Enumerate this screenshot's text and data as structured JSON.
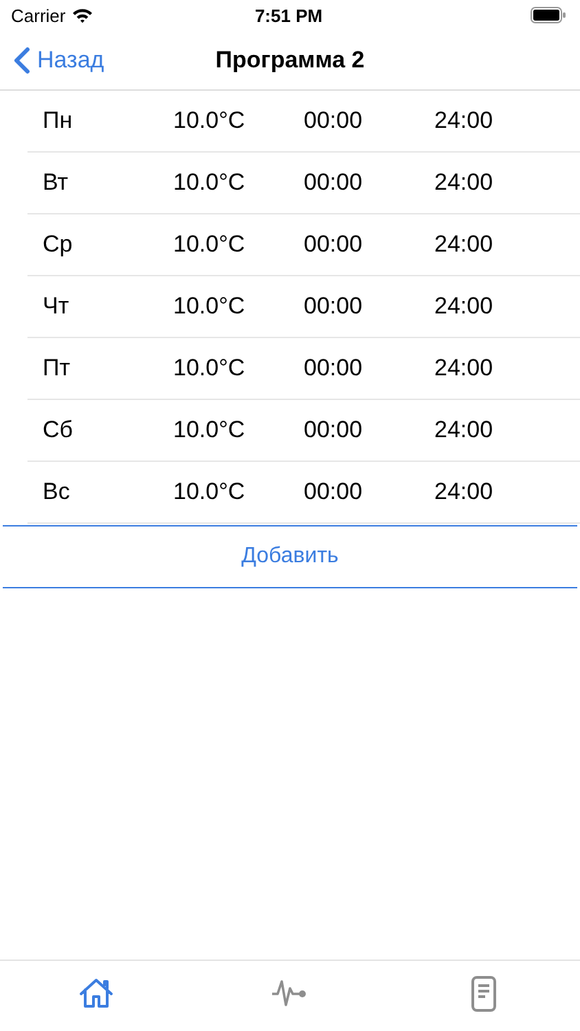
{
  "status_bar": {
    "carrier": "Carrier",
    "time": "7:51 PM"
  },
  "nav": {
    "back": "Назад",
    "title": "Программа 2"
  },
  "rows": [
    {
      "day": "Пн",
      "temperature": "10.0°C",
      "start": "00:00",
      "end": "24:00"
    },
    {
      "day": "Вт",
      "temperature": "10.0°C",
      "start": "00:00",
      "end": "24:00"
    },
    {
      "day": "Ср",
      "temperature": "10.0°C",
      "start": "00:00",
      "end": "24:00"
    },
    {
      "day": "Чт",
      "temperature": "10.0°C",
      "start": "00:00",
      "end": "24:00"
    },
    {
      "day": "Пт",
      "temperature": "10.0°C",
      "start": "00:00",
      "end": "24:00"
    },
    {
      "day": "Сб",
      "temperature": "10.0°C",
      "start": "00:00",
      "end": "24:00"
    },
    {
      "day": "Вс",
      "temperature": "10.0°C",
      "start": "00:00",
      "end": "24:00"
    }
  ],
  "add_button": "Добавить",
  "tabs": [
    {
      "kind": "home",
      "selected": true
    },
    {
      "kind": "activity",
      "selected": false
    },
    {
      "kind": "document",
      "selected": false
    }
  ]
}
